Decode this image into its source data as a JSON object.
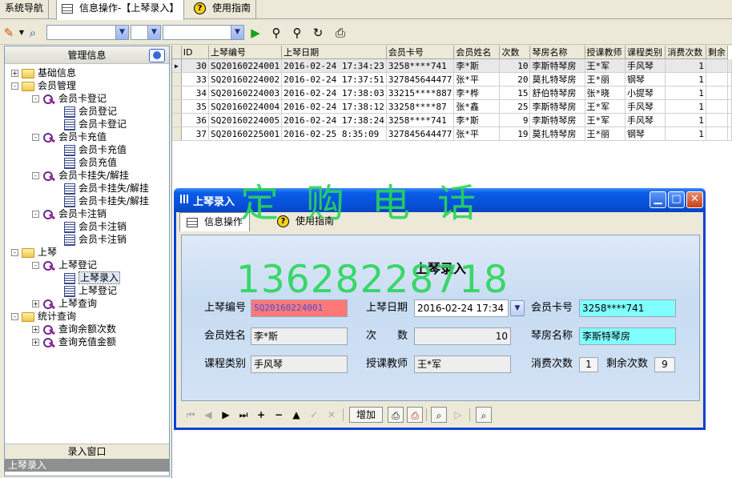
{
  "tabs": [
    "系统导航",
    "信息操作-【上琴录入】",
    "使用指南"
  ],
  "left_pane": {
    "header": "管理信息",
    "tree": [
      {
        "label": "基础信息",
        "icon": "folder-icon",
        "level": 0,
        "expander": "+"
      },
      {
        "label": "会员管理",
        "icon": "folder-icon",
        "level": 0,
        "expander": "-"
      },
      {
        "label": "会员卡登记",
        "icon": "key-icon",
        "level": 1,
        "expander": "-"
      },
      {
        "label": "会员登记",
        "icon": "form-icon",
        "level": 2
      },
      {
        "label": "会员卡登记",
        "icon": "form-icon",
        "level": 2
      },
      {
        "label": "会员卡充值",
        "icon": "key-icon",
        "level": 1,
        "expander": "-"
      },
      {
        "label": "会员卡充值",
        "icon": "form-icon",
        "level": 2
      },
      {
        "label": "会员充值",
        "icon": "form-icon",
        "level": 2
      },
      {
        "label": "会员卡挂失/解挂",
        "icon": "key-icon",
        "level": 1,
        "expander": "-"
      },
      {
        "label": "会员卡挂失/解挂",
        "icon": "form-icon",
        "level": 2
      },
      {
        "label": "会员卡挂失/解挂",
        "icon": "form-icon",
        "level": 2
      },
      {
        "label": "会员卡注销",
        "icon": "key-icon",
        "level": 1,
        "expander": "-"
      },
      {
        "label": "会员卡注销",
        "icon": "form-icon",
        "level": 2
      },
      {
        "label": "会员卡注销",
        "icon": "form-icon",
        "level": 2
      },
      {
        "label": "上琴",
        "icon": "folder-icon",
        "level": 0,
        "expander": "-"
      },
      {
        "label": "上琴登记",
        "icon": "key-icon",
        "level": 1,
        "expander": "-"
      },
      {
        "label": "上琴录入",
        "icon": "form-icon",
        "level": 2,
        "selected": true
      },
      {
        "label": "上琴登记",
        "icon": "form-icon",
        "level": 2
      },
      {
        "label": "上琴查询",
        "icon": "key-icon",
        "level": 1,
        "expander": "+"
      },
      {
        "label": "统计查询",
        "icon": "folder-icon",
        "level": 0,
        "expander": "-"
      },
      {
        "label": "查询余额次数",
        "icon": "key-icon",
        "level": 1,
        "expander": "+"
      },
      {
        "label": "查询充值金额",
        "icon": "key-icon",
        "level": 1,
        "expander": "+"
      }
    ],
    "bottom_title": "录入窗口",
    "bottom_item": "上琴录入"
  },
  "grid": {
    "columns": [
      "ID",
      "上琴编号",
      "上琴日期",
      "会员卡号",
      "会员姓名",
      "次数",
      "琴房名称",
      "授课教师",
      "课程类别",
      "消费次数",
      "剩余"
    ],
    "rows": [
      [
        "30",
        "SQ20160224001",
        "2016-02-24 17:34:23",
        "3258****741",
        "李*斯",
        "10",
        "李斯特琴房",
        "王*军",
        "手风琴",
        "1",
        ""
      ],
      [
        "33",
        "SQ20160224002",
        "2016-02-24 17:37:51",
        "327845644477",
        "张*平",
        "20",
        "莫扎特琴房",
        "王*丽",
        "钢琴",
        "1",
        ""
      ],
      [
        "34",
        "SQ20160224003",
        "2016-02-24 17:38:03",
        "33215****887",
        "李*桦",
        "15",
        "舒伯特琴房",
        "张*晓",
        "小提琴",
        "1",
        ""
      ],
      [
        "35",
        "SQ20160224004",
        "2016-02-24 17:38:12",
        "33258****87",
        "张*鑫",
        "25",
        "李斯特琴房",
        "王*军",
        "手风琴",
        "1",
        ""
      ],
      [
        "36",
        "SQ20160224005",
        "2016-02-24 17:38:24",
        "3258****741",
        "李*斯",
        "9",
        "李斯特琴房",
        "王*军",
        "手风琴",
        "1",
        ""
      ],
      [
        "37",
        "SQ20160225001",
        "2016-02-25 8:35:09",
        "327845644477",
        "张*平",
        "19",
        "莫扎特琴房",
        "王*丽",
        "钢琴",
        "1",
        ""
      ]
    ]
  },
  "dialog": {
    "title": "上琴录入",
    "tabs": [
      "信息操作",
      "使用指南"
    ],
    "form_title": "上琴录入",
    "fields": {
      "sq_no_label": "上琴编号",
      "sq_no": "SQ20160224001",
      "sq_date_label": "上琴日期",
      "sq_date": "2016-02-24 17:34",
      "card_label": "会员卡号",
      "card": "3258****741",
      "name_label": "会员姓名",
      "name": "李*斯",
      "count_label": "次　　数",
      "count": "10",
      "room_label": "琴房名称",
      "room": "李斯特琴房",
      "course_label": "课程类别",
      "course": "手风琴",
      "teacher_label": "授课教师",
      "teacher": "王*军",
      "used_label": "消费次数",
      "used": "1",
      "remain_label": "剩余次数",
      "remain": "9"
    },
    "nav_add_label": "增加"
  },
  "watermark": {
    "line1": "定购电话",
    "line2": "13628228718"
  },
  "colors": {
    "title_bar": "#0a5ce8",
    "required_field": "#ff7878",
    "lookup_field": "#80ffff",
    "watermark": "#29d65a"
  }
}
